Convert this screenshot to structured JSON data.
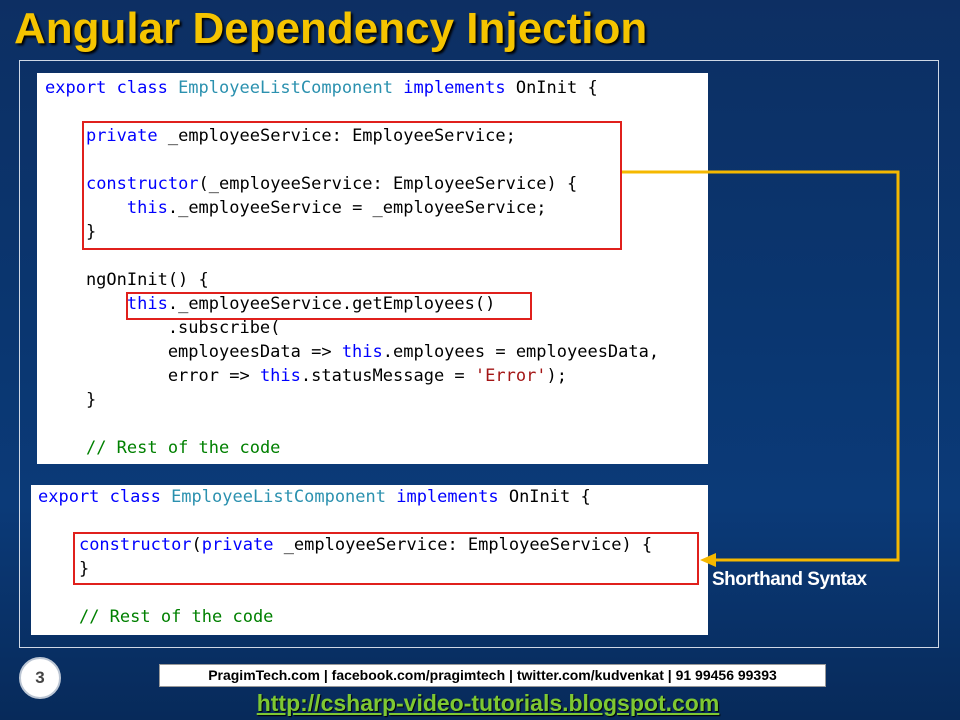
{
  "slide": {
    "title": "Angular Dependency Injection",
    "page_number": "3"
  },
  "colors": {
    "title": "#f5c400",
    "keyword": "#0000ff",
    "type_name": "#2b91af",
    "comment": "#008000",
    "string": "#a31515",
    "highlight_box": "#e0201c",
    "connector": "#f5b800",
    "url": "#7ec832"
  },
  "code_full": {
    "lines": [
      [
        [
          "kw",
          "export class "
        ],
        [
          "ty",
          "EmployeeListComponent "
        ],
        [
          "kw",
          "implements "
        ],
        [
          "tx",
          "OnInit {"
        ]
      ],
      [],
      [
        [
          "tx",
          "    "
        ],
        [
          "kw",
          "private "
        ],
        [
          "tx",
          "_employeeService: EmployeeService;"
        ]
      ],
      [],
      [
        [
          "tx",
          "    "
        ],
        [
          "kw",
          "constructor"
        ],
        [
          "tx",
          "(_employeeService: EmployeeService) {"
        ]
      ],
      [
        [
          "tx",
          "        "
        ],
        [
          "kw",
          "this"
        ],
        [
          "tx",
          "._employeeService = _employeeService;"
        ]
      ],
      [
        [
          "tx",
          "    }"
        ]
      ],
      [],
      [
        [
          "tx",
          "    ngOnInit() {"
        ]
      ],
      [
        [
          "tx",
          "        "
        ],
        [
          "kw",
          "this"
        ],
        [
          "tx",
          "._employeeService.getEmployees()"
        ]
      ],
      [
        [
          "tx",
          "            .subscribe("
        ]
      ],
      [
        [
          "tx",
          "            employeesData => "
        ],
        [
          "kw",
          "this"
        ],
        [
          "tx",
          ".employees = employeesData,"
        ]
      ],
      [
        [
          "tx",
          "            error => "
        ],
        [
          "kw",
          "this"
        ],
        [
          "tx",
          ".statusMessage = "
        ],
        [
          "st",
          "'Error'"
        ],
        [
          "tx",
          ");"
        ]
      ],
      [
        [
          "tx",
          "    }"
        ]
      ],
      [],
      [
        [
          "tx",
          "    "
        ],
        [
          "cm",
          "// Rest of the code"
        ]
      ]
    ]
  },
  "code_short": {
    "lines": [
      [
        [
          "kw",
          "export class "
        ],
        [
          "ty",
          "EmployeeListComponent "
        ],
        [
          "kw",
          "implements "
        ],
        [
          "tx",
          "OnInit {"
        ]
      ],
      [],
      [
        [
          "tx",
          "    "
        ],
        [
          "kw",
          "constructor"
        ],
        [
          "tx",
          "("
        ],
        [
          "kw",
          "private "
        ],
        [
          "tx",
          "_employeeService: EmployeeService) {"
        ]
      ],
      [
        [
          "tx",
          "    }"
        ]
      ],
      [],
      [
        [
          "tx",
          "    "
        ],
        [
          "cm",
          "// Rest of the code"
        ]
      ]
    ]
  },
  "callout": {
    "label": "Shorthand Syntax"
  },
  "footer": {
    "contact": "PragimTech.com | facebook.com/pragimtech | twitter.com/kudvenkat | 91 99456 99393",
    "blog_url": "http://csharp-video-tutorials.blogspot.com"
  }
}
